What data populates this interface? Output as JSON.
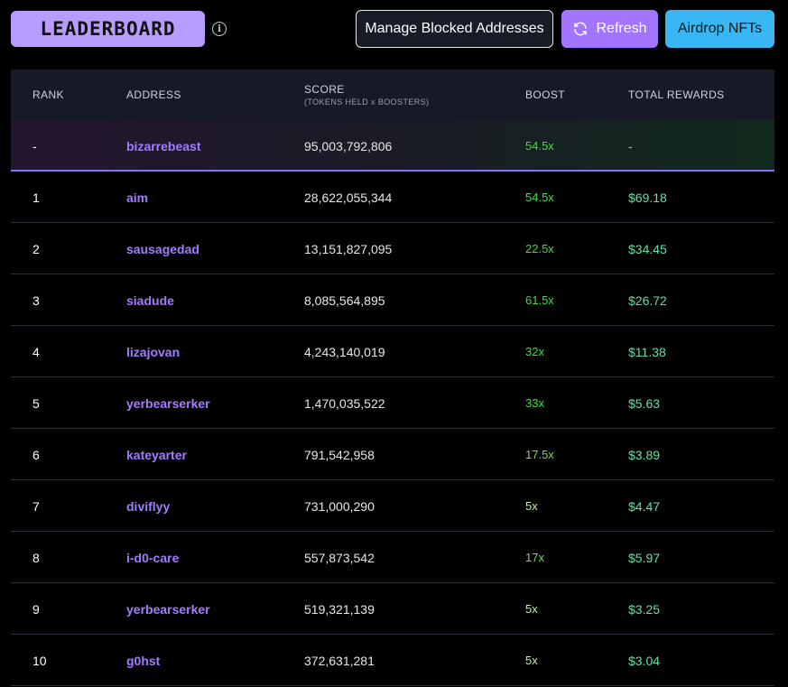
{
  "header": {
    "logo_text": "LEADERBOARD",
    "info_icon": "info-icon",
    "manage_label": "Manage Blocked Addresses",
    "refresh_label": "Refresh",
    "airdrop_label": "Airdrop NFTs"
  },
  "colors": {
    "logo_bg": "#b99cff",
    "refresh_bg": "#a274ff",
    "airdrop_bg": "#38b7f2",
    "address": "#a27cff",
    "reward": "#5fe3a6",
    "boost_bright": "#39e039",
    "boost_mid": "#7ed957",
    "boost_pale": "#c8f0a0"
  },
  "columns": {
    "rank": "RANK",
    "address": "ADDRESS",
    "score": "SCORE",
    "score_sub": "(TOKENS HELD x BOOSTERS)",
    "boost": "BOOST",
    "rewards": "TOTAL REWARDS"
  },
  "highlight": {
    "rank": "-",
    "address": "bizarrebeast",
    "score": "95,003,792,806",
    "boost": "54.5x",
    "rewards": "-"
  },
  "rows": [
    {
      "rank": "1",
      "address": "aim",
      "score": "28,622,055,344",
      "boost": "54.5x",
      "rewards": "$69.18",
      "tier": "bright"
    },
    {
      "rank": "2",
      "address": "sausagedad",
      "score": "13,151,827,095",
      "boost": "22.5x",
      "rewards": "$34.45",
      "tier": "bright"
    },
    {
      "rank": "3",
      "address": "siadude",
      "score": "8,085,564,895",
      "boost": "61.5x",
      "rewards": "$26.72",
      "tier": "bright"
    },
    {
      "rank": "4",
      "address": "lizajovan",
      "score": "4,243,140,019",
      "boost": "32x",
      "rewards": "$11.38",
      "tier": "bright"
    },
    {
      "rank": "5",
      "address": "yerbearserker",
      "score": "1,470,035,522",
      "boost": "33x",
      "rewards": "$5.63",
      "tier": "bright"
    },
    {
      "rank": "6",
      "address": "kateyarter",
      "score": "791,542,958",
      "boost": "17.5x",
      "rewards": "$3.89",
      "tier": "mid"
    },
    {
      "rank": "7",
      "address": "diviflyy",
      "score": "731,000,290",
      "boost": "5x",
      "rewards": "$4.47",
      "tier": "pale"
    },
    {
      "rank": "8",
      "address": "i-d0-care",
      "score": "557,873,542",
      "boost": "17x",
      "rewards": "$5.97",
      "tier": "mid"
    },
    {
      "rank": "9",
      "address": "yerbearserker",
      "score": "519,321,139",
      "boost": "5x",
      "rewards": "$3.25",
      "tier": "pale"
    },
    {
      "rank": "10",
      "address": "g0hst",
      "score": "372,631,281",
      "boost": "5x",
      "rewards": "$3.04",
      "tier": "pale"
    }
  ]
}
